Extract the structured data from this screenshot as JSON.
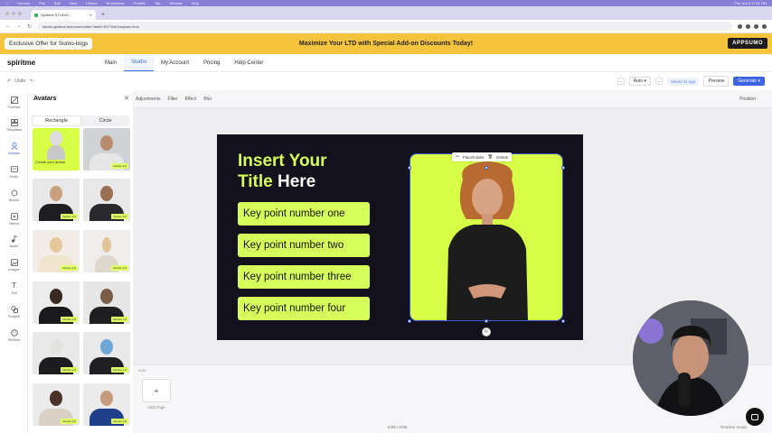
{
  "macbar": {
    "items": [
      "Chrome",
      "File",
      "Edit",
      "View",
      "History",
      "Bookmarks",
      "Profiles",
      "Tab",
      "Window",
      "Help"
    ],
    "clock": "Thu Jun 6 11:31 PM"
  },
  "browser": {
    "tab_title": "Spiritme STUDIO",
    "url": "studio.spiritme.tech/user/editor?draft=3977&isTemplate=true"
  },
  "promo": {
    "left_label": "Exclusive Offer for Sumo-lings",
    "center_text": "Maximize Your LTD with Special Add-on Discounts Today!",
    "brand": "APPSUMO"
  },
  "header": {
    "logo": "spiritme",
    "nav": [
      {
        "label": "Main",
        "active": false
      },
      {
        "label": "Studio",
        "active": true
      },
      {
        "label": "My Account",
        "active": false
      },
      {
        "label": "Pricing",
        "active": false
      },
      {
        "label": "Help Center",
        "active": false
      }
    ]
  },
  "toolbar": {
    "undo": "Undo",
    "zoom": "Auto",
    "saved": "Saved 4s ago",
    "preview": "Preview",
    "generate": "Generate"
  },
  "rail": {
    "items": [
      "Formats",
      "Templates",
      "Avatars",
      "Script",
      "Blocks",
      "Videos",
      "Audio",
      "Images",
      "Text",
      "Shapes",
      "Stickers"
    ],
    "active": "Avatars"
  },
  "panel": {
    "title": "Avatars",
    "tabs": [
      "Rectangle",
      "Circle"
    ],
    "active_tab": "Rectangle",
    "create_label": "Create your avatar",
    "tag": "Version 2.0"
  },
  "subtoolbar": {
    "items": [
      "Adjustments",
      "Filter",
      "Effect",
      "Blur"
    ],
    "position": "Position"
  },
  "slide": {
    "title_line1": "Insert Your",
    "title_line2a": "Title",
    "title_line2b": "Here",
    "key_points": [
      "Key point number one",
      "Key point number two",
      "Key point number three",
      "Key point number four"
    ],
    "context_menu": [
      "Placeholder",
      "Delete"
    ],
    "accent": "#d7ff5c",
    "background": "#13111b"
  },
  "timeline": {
    "time_marker": "0:05",
    "add_page": "Add Page",
    "counter": "0:00 / 0:05",
    "scale": "Timeline Scale"
  }
}
